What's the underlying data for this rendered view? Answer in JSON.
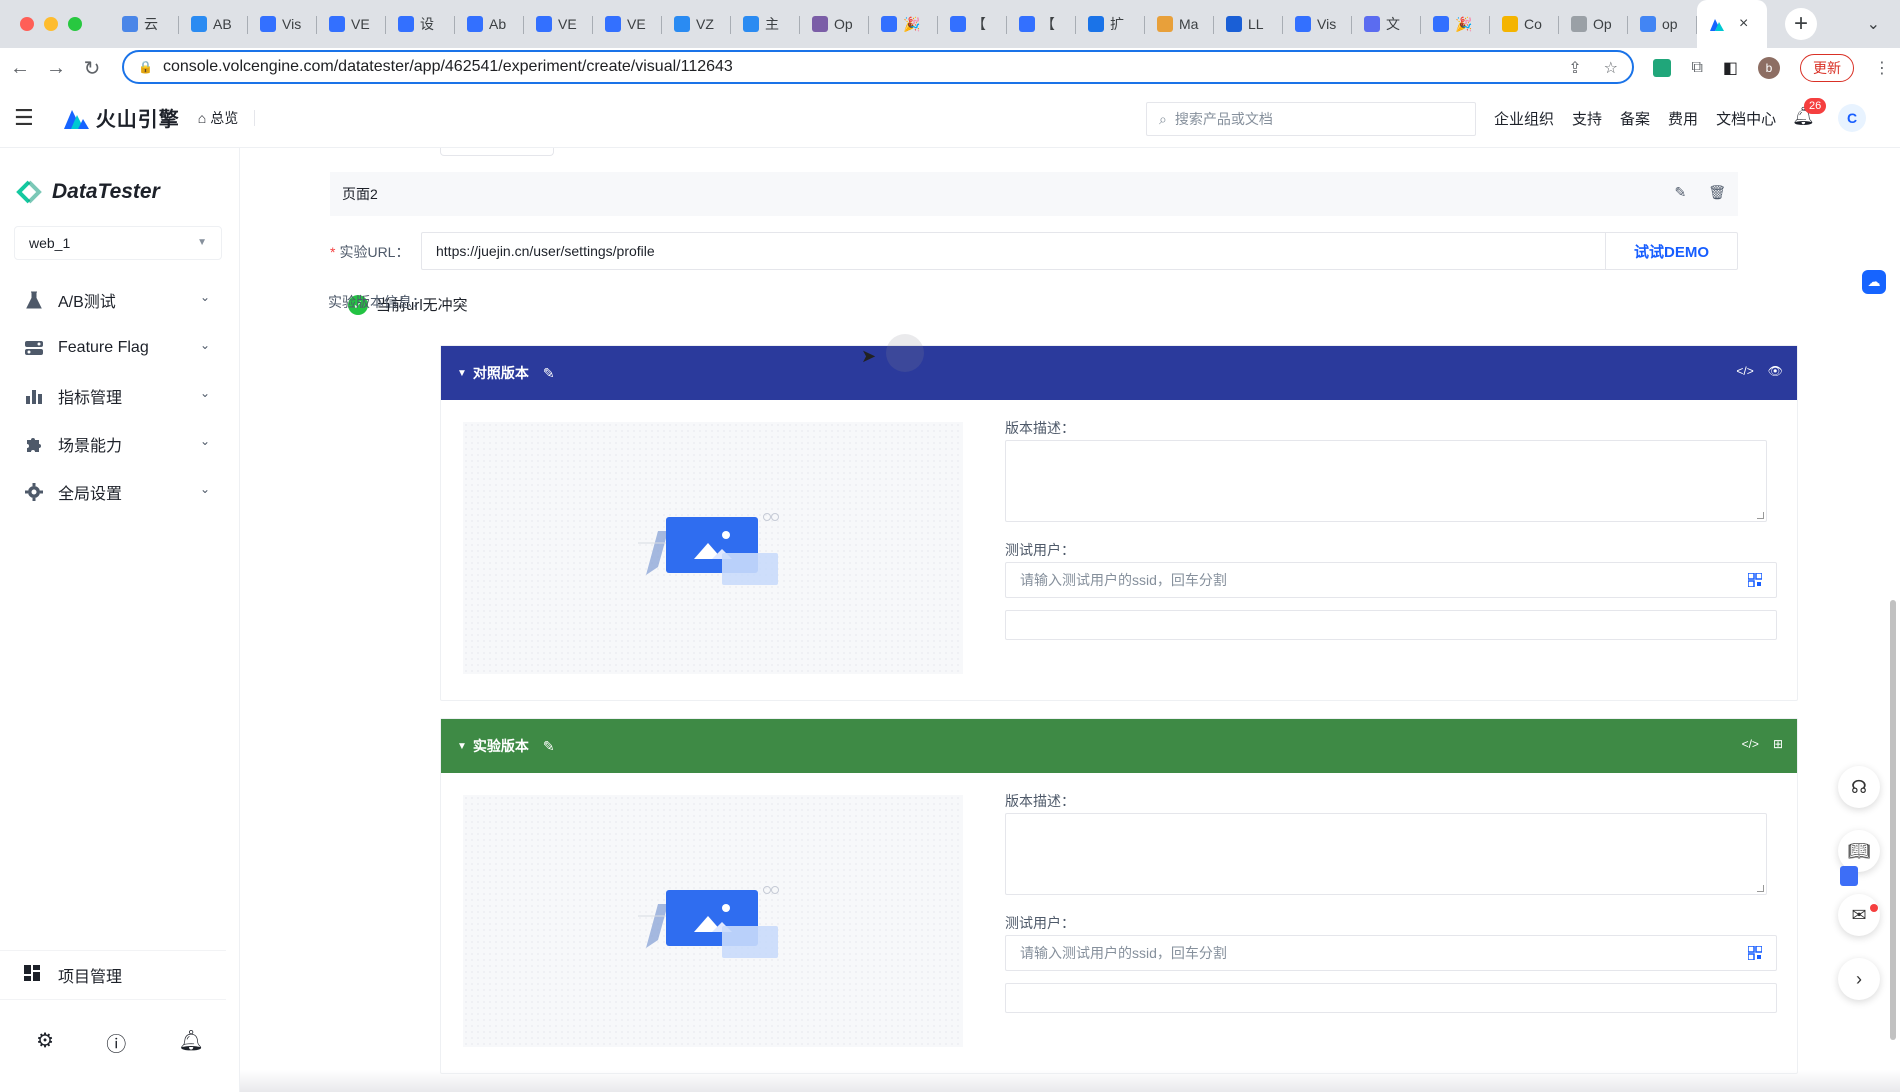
{
  "browser": {
    "tabs": [
      {
        "label": "云",
        "color": "#4a86e8"
      },
      {
        "label": "AB",
        "color": "#2a8bf2"
      },
      {
        "label": "Vis",
        "color": "#3370ff"
      },
      {
        "label": "VE",
        "color": "#3370ff"
      },
      {
        "label": "设",
        "color": "#3370ff"
      },
      {
        "label": "Ab",
        "color": "#3370ff"
      },
      {
        "label": "VE",
        "color": "#3370ff"
      },
      {
        "label": "VE",
        "color": "#3370ff"
      },
      {
        "label": "VZ",
        "color": "#2a8bf2"
      },
      {
        "label": "主",
        "color": "#2a8bf2"
      },
      {
        "label": "Op",
        "color": "#7b5ea7"
      },
      {
        "label": "🎉",
        "color": "#3370ff"
      },
      {
        "label": "【",
        "color": "#3370ff"
      },
      {
        "label": "【",
        "color": "#3370ff"
      },
      {
        "label": "扩",
        "color": "#1a73e8"
      },
      {
        "label": "Ma",
        "color": "#e8a03a"
      },
      {
        "label": "LL",
        "color": "#1a5fd6"
      },
      {
        "label": "Vis",
        "color": "#3370ff"
      },
      {
        "label": "文",
        "color": "#5b6cf0"
      },
      {
        "label": "🎉",
        "color": "#3370ff"
      },
      {
        "label": "Co",
        "color": "#f4b400"
      },
      {
        "label": "Op",
        "color": "#9aa0a6"
      },
      {
        "label": "op",
        "color": "#4285f4"
      }
    ],
    "active_tab_close": "×",
    "url": "console.volcengine.com/datatester/app/462541/experiment/create/visual/112643",
    "profile_initial": "b",
    "update_label": "更新"
  },
  "header": {
    "brand": "火山引擎",
    "home": "总览",
    "search_placeholder": "搜索产品或文档",
    "links": [
      "企业组织",
      "支持",
      "备案",
      "费用",
      "文档中心"
    ],
    "notification_count": "26",
    "avatar": "C"
  },
  "sidebar": {
    "product": "DataTester",
    "project": "web_1",
    "items": [
      {
        "label": "A/B测试",
        "icon": "flask-icon"
      },
      {
        "label": "Feature Flag",
        "icon": "flag-icon"
      },
      {
        "label": "指标管理",
        "icon": "bar-chart-icon"
      },
      {
        "label": "场景能力",
        "icon": "puzzle-icon"
      },
      {
        "label": "全局设置",
        "icon": "gear-icon"
      }
    ],
    "project_mgmt": "项目管理"
  },
  "main": {
    "page_name": "页面2",
    "url_label": "实验URL：",
    "url_value": "https://juejin.cn/user/settings/profile",
    "demo_button": "试试DEMO",
    "conflict_status": "当前url无冲突",
    "versions_label": "实验版本信息：",
    "variants": [
      {
        "title": "对照版本",
        "color": "#2b3a9c",
        "desc_label": "版本描述：",
        "users_label": "测试用户：",
        "users_placeholder": "请输入测试用户的ssid，回车分割"
      },
      {
        "title": "实验版本",
        "color": "#3e8a45",
        "desc_label": "版本描述：",
        "users_label": "测试用户：",
        "users_placeholder": "请输入测试用户的ssid，回车分割"
      }
    ]
  }
}
